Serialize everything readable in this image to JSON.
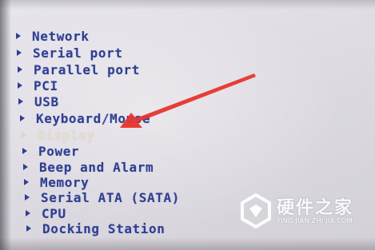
{
  "menu": {
    "items": [
      {
        "label": "Network"
      },
      {
        "label": "Serial port"
      },
      {
        "label": "Parallel port"
      },
      {
        "label": "PCI"
      },
      {
        "label": "USB"
      },
      {
        "label": "Keyboard/Mouse"
      },
      {
        "label": "Display"
      },
      {
        "label": "Power"
      },
      {
        "label": "Beep and Alarm"
      },
      {
        "label": "Memory"
      },
      {
        "label": "Serial ATA (SATA)"
      },
      {
        "label": "CPU"
      },
      {
        "label": "Docking Station"
      }
    ],
    "selected_label": "Display"
  },
  "watermark": {
    "title": "硬件之家",
    "subtitle": "YING JIAN ZHI JIA.COM"
  },
  "colors": {
    "item_text": "#2f3f93",
    "selected_text": "#e6ddd0",
    "annotation_arrow": "#e8342c"
  }
}
